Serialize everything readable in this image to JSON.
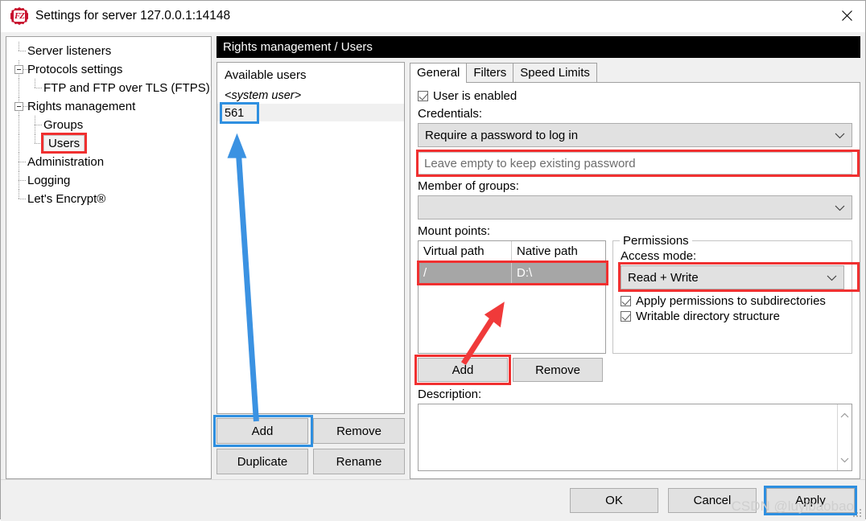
{
  "window": {
    "title": "Settings for server 127.0.0.1:14148",
    "icon": "filezilla-icon",
    "close_label": "✕"
  },
  "tree": {
    "items": [
      {
        "label": "Server listeners",
        "level": 1,
        "expander": "none",
        "selected": false
      },
      {
        "label": "Protocols settings",
        "level": 1,
        "expander": "collapse",
        "selected": false
      },
      {
        "label": "FTP and FTP over TLS (FTPS)",
        "level": 2,
        "expander": "none",
        "selected": false
      },
      {
        "label": "Rights management",
        "level": 1,
        "expander": "collapse",
        "selected": false
      },
      {
        "label": "Groups",
        "level": 2,
        "expander": "none",
        "selected": false
      },
      {
        "label": "Users",
        "level": 2,
        "expander": "none",
        "selected": true
      },
      {
        "label": "Administration",
        "level": 1,
        "expander": "none",
        "selected": false
      },
      {
        "label": "Logging",
        "level": 1,
        "expander": "none",
        "selected": false
      },
      {
        "label": "Let's Encrypt®",
        "level": 1,
        "expander": "none",
        "selected": false
      }
    ]
  },
  "users": {
    "heading": "Available users",
    "rows": [
      {
        "label": "<system user>",
        "italic": true,
        "highlighted": false
      },
      {
        "label": "561",
        "italic": false,
        "highlighted": true
      }
    ],
    "buttons": {
      "add": "Add",
      "remove": "Remove",
      "duplicate": "Duplicate",
      "rename": "Rename"
    }
  },
  "header": {
    "breadcrumb": "Rights management / Users"
  },
  "tabs": [
    {
      "label": "General",
      "active": true
    },
    {
      "label": "Filters",
      "active": false
    },
    {
      "label": "Speed Limits",
      "active": false
    }
  ],
  "general": {
    "user_enabled_label": "User is enabled",
    "user_enabled_checked": true,
    "credentials_label": "Credentials:",
    "credentials_value": "Require a password to log in",
    "password_placeholder": "Leave empty to keep existing password",
    "password_value": "",
    "member_of_groups_label": "Member of groups:",
    "member_of_groups_value": "",
    "mount_points_label": "Mount points:",
    "mount_table": {
      "columns": [
        "Virtual path",
        "Native path"
      ],
      "rows": [
        {
          "virtual_path": "/",
          "native_path": "D:\\",
          "selected": true
        }
      ]
    },
    "permissions": {
      "legend": "Permissions",
      "access_mode_label": "Access mode:",
      "access_mode_value": "Read + Write",
      "checkboxes": [
        {
          "label": "Apply permissions to subdirectories",
          "checked": true
        },
        {
          "label": "Writable directory structure",
          "checked": true
        }
      ]
    },
    "mount_buttons": {
      "add": "Add",
      "remove": "Remove"
    },
    "description_label": "Description:",
    "description_value": ""
  },
  "footer": {
    "ok": "OK",
    "cancel": "Cancel",
    "apply": "Apply"
  },
  "watermark": "CSDN @luyibaobao",
  "annotation_colors": {
    "red": "#f03030",
    "blue": "#2e8fe0"
  }
}
